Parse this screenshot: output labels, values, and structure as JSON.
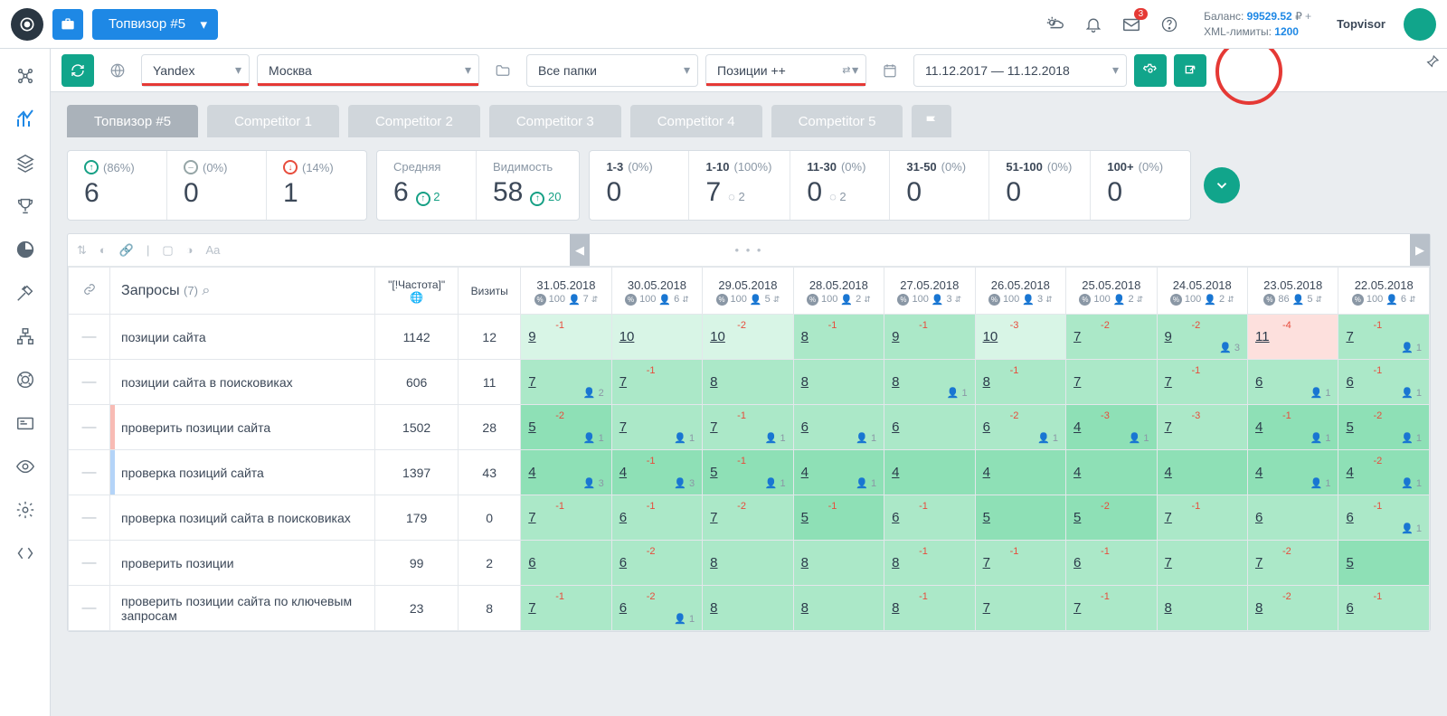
{
  "top": {
    "project": "Топвизор #5",
    "mail_badge": "3",
    "balance_label": "Баланс:",
    "balance_value": "99529.52",
    "balance_currency": "₽",
    "xml_label": "XML-лимиты:",
    "xml_value": "1200",
    "user": "Topvisor"
  },
  "filters": {
    "engine": "Yandex",
    "region": "Москва",
    "folder": "Все папки",
    "mode": "Позиции ++",
    "dates": "11.12.2017 — 11.12.2018"
  },
  "tabs": [
    "Топвизор #5",
    "Competitor 1",
    "Competitor 2",
    "Competitor 3",
    "Competitor 4",
    "Competitor 5"
  ],
  "stats_movement": [
    {
      "icon": "up",
      "pct": "(86%)",
      "value": "6"
    },
    {
      "icon": "eq",
      "pct": "(0%)",
      "value": "0"
    },
    {
      "icon": "dn",
      "pct": "(14%)",
      "value": "1"
    }
  ],
  "stats_avg": [
    {
      "label": "Средняя",
      "value": "6",
      "delta": "2",
      "dir": "up"
    },
    {
      "label": "Видимость",
      "value": "58",
      "delta": "20",
      "dir": "up"
    }
  ],
  "stats_buckets": [
    {
      "label": "1-3",
      "pct": "(0%)",
      "value": "0",
      "delta": null
    },
    {
      "label": "1-10",
      "pct": "(100%)",
      "value": "7",
      "delta": "2",
      "dir": "dn"
    },
    {
      "label": "11-30",
      "pct": "(0%)",
      "value": "0",
      "delta": "2",
      "dir": "dn"
    },
    {
      "label": "31-50",
      "pct": "(0%)",
      "value": "0",
      "delta": null
    },
    {
      "label": "51-100",
      "pct": "(0%)",
      "value": "0",
      "delta": null
    },
    {
      "label": "100+",
      "pct": "(0%)",
      "value": "0",
      "delta": null
    }
  ],
  "table": {
    "query_header": "Запросы",
    "query_count": "(7)",
    "freq_header": "\"[!Частота]\"",
    "visits_header": "Визиты",
    "dates": [
      "31.05.2018",
      "30.05.2018",
      "29.05.2018",
      "28.05.2018",
      "27.05.2018",
      "26.05.2018",
      "25.05.2018",
      "24.05.2018",
      "23.05.2018",
      "22.05.2018"
    ],
    "date_sub": [
      {
        "pct": "100",
        "u": "7"
      },
      {
        "pct": "100",
        "u": "6"
      },
      {
        "pct": "100",
        "u": "5"
      },
      {
        "pct": "100",
        "u": "2"
      },
      {
        "pct": "100",
        "u": "3"
      },
      {
        "pct": "100",
        "u": "3"
      },
      {
        "pct": "100",
        "u": "2"
      },
      {
        "pct": "100",
        "u": "2"
      },
      {
        "pct": "86",
        "u": "5"
      },
      {
        "pct": "100",
        "u": "6"
      }
    ],
    "rows": [
      {
        "q": "позиции сайта",
        "freq": "1142",
        "visits": "12",
        "mark": null,
        "cells": [
          {
            "v": "9",
            "d": "-1",
            "c": "g4",
            "m": null
          },
          {
            "v": "10",
            "d": null,
            "c": "g4",
            "m": null
          },
          {
            "v": "10",
            "d": "-2",
            "c": "g4",
            "m": null
          },
          {
            "v": "8",
            "d": "-1",
            "c": "g2",
            "m": null
          },
          {
            "v": "9",
            "d": "-1",
            "c": "g2",
            "m": null
          },
          {
            "v": "10",
            "d": "-3",
            "c": "g4",
            "m": null
          },
          {
            "v": "7",
            "d": "-2",
            "c": "g2",
            "m": null
          },
          {
            "v": "9",
            "d": "-2",
            "c": "g2",
            "m": "3"
          },
          {
            "v": "11",
            "d": "-4",
            "c": "r1",
            "m": null
          },
          {
            "v": "7",
            "d": "-1",
            "c": "g2",
            "m": "1"
          }
        ]
      },
      {
        "q": "позиции сайта в поисковиках",
        "freq": "606",
        "visits": "11",
        "mark": null,
        "cells": [
          {
            "v": "7",
            "d": null,
            "c": "g2",
            "m": "2"
          },
          {
            "v": "7",
            "d": "-1",
            "c": "g2",
            "m": null
          },
          {
            "v": "8",
            "d": null,
            "c": "g2",
            "m": null
          },
          {
            "v": "8",
            "d": null,
            "c": "g2",
            "m": null
          },
          {
            "v": "8",
            "d": null,
            "c": "g2",
            "m": "1"
          },
          {
            "v": "8",
            "d": "-1",
            "c": "g2",
            "m": null
          },
          {
            "v": "7",
            "d": null,
            "c": "g2",
            "m": null
          },
          {
            "v": "7",
            "d": "-1",
            "c": "g2",
            "m": null
          },
          {
            "v": "6",
            "d": null,
            "c": "g2",
            "m": "1"
          },
          {
            "v": "6",
            "d": "-1",
            "c": "g2",
            "m": "1"
          }
        ]
      },
      {
        "q": "проверить позиции сайта",
        "freq": "1502",
        "visits": "28",
        "mark": "#f8bbb4",
        "cells": [
          {
            "v": "5",
            "d": "-2",
            "c": "g3",
            "m": "1"
          },
          {
            "v": "7",
            "d": null,
            "c": "g2",
            "m": "1"
          },
          {
            "v": "7",
            "d": "-1",
            "c": "g2",
            "m": "1"
          },
          {
            "v": "6",
            "d": null,
            "c": "g2",
            "m": "1"
          },
          {
            "v": "6",
            "d": null,
            "c": "g2",
            "m": null
          },
          {
            "v": "6",
            "d": "-2",
            "c": "g2",
            "m": "1"
          },
          {
            "v": "4",
            "d": "-3",
            "c": "g3",
            "m": "1"
          },
          {
            "v": "7",
            "d": "-3",
            "c": "g2",
            "m": null
          },
          {
            "v": "4",
            "d": "-1",
            "c": "g3",
            "m": "1"
          },
          {
            "v": "5",
            "d": "-2",
            "c": "g3",
            "m": "1"
          }
        ]
      },
      {
        "q": "проверка позиций сайта",
        "freq": "1397",
        "visits": "43",
        "mark": "#b4d4f8",
        "cells": [
          {
            "v": "4",
            "d": null,
            "c": "g3",
            "m": "3"
          },
          {
            "v": "4",
            "d": "-1",
            "c": "g3",
            "m": "3"
          },
          {
            "v": "5",
            "d": "-1",
            "c": "g3",
            "m": "1"
          },
          {
            "v": "4",
            "d": null,
            "c": "g3",
            "m": "1"
          },
          {
            "v": "4",
            "d": null,
            "c": "g3",
            "m": null
          },
          {
            "v": "4",
            "d": null,
            "c": "g3",
            "m": null
          },
          {
            "v": "4",
            "d": null,
            "c": "g3",
            "m": null
          },
          {
            "v": "4",
            "d": null,
            "c": "g3",
            "m": null
          },
          {
            "v": "4",
            "d": null,
            "c": "g3",
            "m": "1"
          },
          {
            "v": "4",
            "d": "-2",
            "c": "g3",
            "m": "1"
          }
        ]
      },
      {
        "q": "проверка позиций сайта в поисковиках",
        "freq": "179",
        "visits": "0",
        "mark": null,
        "cells": [
          {
            "v": "7",
            "d": "-1",
            "c": "g2",
            "m": null
          },
          {
            "v": "6",
            "d": "-1",
            "c": "g2",
            "m": null
          },
          {
            "v": "7",
            "d": "-2",
            "c": "g2",
            "m": null
          },
          {
            "v": "5",
            "d": "-1",
            "c": "g3",
            "m": null
          },
          {
            "v": "6",
            "d": "-1",
            "c": "g2",
            "m": null
          },
          {
            "v": "5",
            "d": null,
            "c": "g3",
            "m": null
          },
          {
            "v": "5",
            "d": "-2",
            "c": "g3",
            "m": null
          },
          {
            "v": "7",
            "d": "-1",
            "c": "g2",
            "m": null
          },
          {
            "v": "6",
            "d": null,
            "c": "g2",
            "m": null
          },
          {
            "v": "6",
            "d": "-1",
            "c": "g2",
            "m": "1"
          }
        ]
      },
      {
        "q": "проверить позиции",
        "freq": "99",
        "visits": "2",
        "mark": null,
        "cells": [
          {
            "v": "6",
            "d": null,
            "c": "g2",
            "m": null
          },
          {
            "v": "6",
            "d": "-2",
            "c": "g2",
            "m": null
          },
          {
            "v": "8",
            "d": null,
            "c": "g2",
            "m": null
          },
          {
            "v": "8",
            "d": null,
            "c": "g2",
            "m": null
          },
          {
            "v": "8",
            "d": "-1",
            "c": "g2",
            "m": null
          },
          {
            "v": "7",
            "d": "-1",
            "c": "g2",
            "m": null
          },
          {
            "v": "6",
            "d": "-1",
            "c": "g2",
            "m": null
          },
          {
            "v": "7",
            "d": null,
            "c": "g2",
            "m": null
          },
          {
            "v": "7",
            "d": "-2",
            "c": "g2",
            "m": null
          },
          {
            "v": "5",
            "d": null,
            "c": "g3",
            "m": null
          }
        ]
      },
      {
        "q": "проверить позиции сайта по ключевым запросам",
        "freq": "23",
        "visits": "8",
        "mark": null,
        "cells": [
          {
            "v": "7",
            "d": "-1",
            "c": "g2",
            "m": null
          },
          {
            "v": "6",
            "d": "-2",
            "c": "g2",
            "m": "1"
          },
          {
            "v": "8",
            "d": null,
            "c": "g2",
            "m": null
          },
          {
            "v": "8",
            "d": null,
            "c": "g2",
            "m": null
          },
          {
            "v": "8",
            "d": "-1",
            "c": "g2",
            "m": null
          },
          {
            "v": "7",
            "d": null,
            "c": "g2",
            "m": null
          },
          {
            "v": "7",
            "d": "-1",
            "c": "g2",
            "m": null
          },
          {
            "v": "8",
            "d": null,
            "c": "g2",
            "m": null
          },
          {
            "v": "8",
            "d": "-2",
            "c": "g2",
            "m": null
          },
          {
            "v": "6",
            "d": "-1",
            "c": "g2",
            "m": null
          }
        ]
      }
    ]
  }
}
